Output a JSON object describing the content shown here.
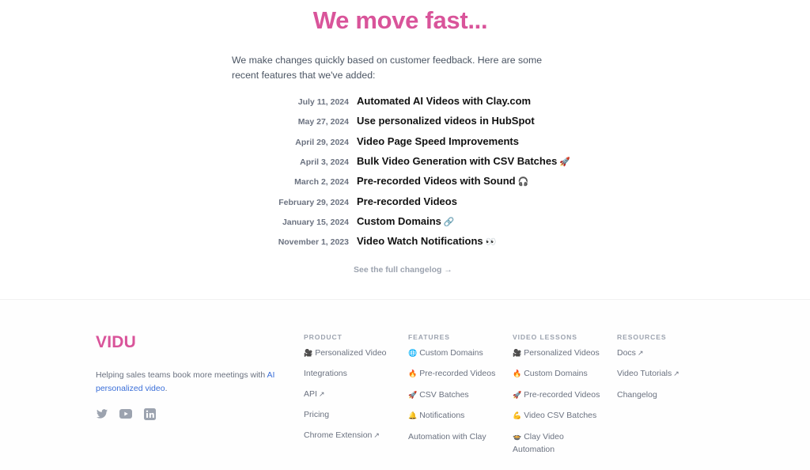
{
  "colors": {
    "brand_pink": "#d9549a",
    "link_blue": "#3b6fd8",
    "muted_text": "#6b7280",
    "heading_text": "#111111"
  },
  "hero": {
    "title": "We move fast...",
    "intro": "We make changes quickly based on customer feedback. Here are some recent features that we've added:"
  },
  "changelog": [
    {
      "date": "July 11, 2024",
      "title": "Automated AI Videos with Clay.com",
      "emoji": ""
    },
    {
      "date": "May 27, 2024",
      "title": "Use personalized videos in HubSpot",
      "emoji": ""
    },
    {
      "date": "April 29, 2024",
      "title": "Video Page Speed Improvements",
      "emoji": ""
    },
    {
      "date": "April 3, 2024",
      "title": "Bulk Video Generation with CSV Batches",
      "emoji": "🚀"
    },
    {
      "date": "March 2, 2024",
      "title": "Pre-recorded Videos with Sound",
      "emoji": "🎧"
    },
    {
      "date": "February 29, 2024",
      "title": "Pre-recorded Videos",
      "emoji": ""
    },
    {
      "date": "January 15, 2024",
      "title": "Custom Domains",
      "emoji": "🔗"
    },
    {
      "date": "November 1, 2023",
      "title": "Video Watch Notifications",
      "emoji": "👀"
    }
  ],
  "full_changelog_link": "See the full changelog →",
  "footer": {
    "logo": "VIDU",
    "tagline_prefix": "Helping sales teams book more meetings with ",
    "tagline_link": "AI personalized video",
    "tagline_suffix": ".",
    "socials": [
      {
        "icon": "twitter-icon"
      },
      {
        "icon": "youtube-icon"
      },
      {
        "icon": "linkedin-icon"
      }
    ],
    "columns": [
      {
        "heading": "PRODUCT",
        "items": [
          {
            "icon": "🎥",
            "label": "Personalized Video",
            "external": false
          },
          {
            "icon": "",
            "label": "Integrations",
            "external": false
          },
          {
            "icon": "",
            "label": "API",
            "external": true
          },
          {
            "icon": "",
            "label": "Pricing",
            "external": false
          },
          {
            "icon": "",
            "label": "Chrome Extension",
            "external": true
          }
        ]
      },
      {
        "heading": "FEATURES",
        "items": [
          {
            "icon": "🌐",
            "label": "Custom Domains",
            "external": false
          },
          {
            "icon": "🔥",
            "label": "Pre-recorded Videos",
            "external": false
          },
          {
            "icon": "🚀",
            "label": "CSV Batches",
            "external": false
          },
          {
            "icon": "🔔",
            "label": "Notifications",
            "external": false
          },
          {
            "icon": "",
            "label": "Automation with Clay",
            "external": false
          }
        ]
      },
      {
        "heading": "VIDEO LESSONS",
        "items": [
          {
            "icon": "🎥",
            "label": "Personalized Videos",
            "external": false
          },
          {
            "icon": "🔥",
            "label": "Custom Domains",
            "external": false
          },
          {
            "icon": "🚀",
            "label": "Pre-recorded Videos",
            "external": false
          },
          {
            "icon": "💪",
            "label": "Video CSV Batches",
            "external": false
          },
          {
            "icon": "🍲",
            "label": "Clay Video Automation",
            "external": false
          }
        ]
      },
      {
        "heading": "RESOURCES",
        "items": [
          {
            "icon": "",
            "label": "Docs",
            "external": true
          },
          {
            "icon": "",
            "label": "Video Tutorials",
            "external": true
          },
          {
            "icon": "",
            "label": "Changelog",
            "external": false
          }
        ]
      }
    ],
    "external_arrow": "↗"
  }
}
